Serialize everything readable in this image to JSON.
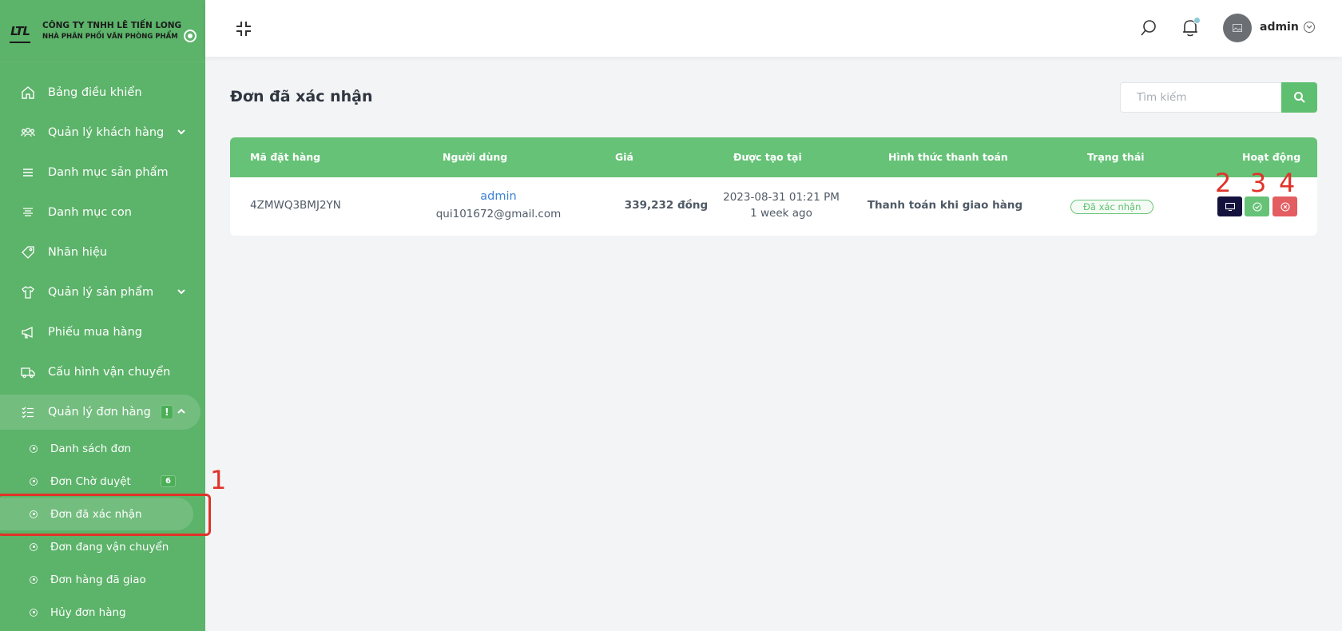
{
  "brand": {
    "logo": "LTL",
    "line1": "CÔNG TY TNHH LÊ TIẾN LONG",
    "line2": "NHÀ PHÂN PHỐI VĂN PHÒNG PHẨM"
  },
  "sidebar": {
    "items": [
      {
        "label": "Bảng điều khiển",
        "icon": "home-icon"
      },
      {
        "label": "Quản lý khách hàng",
        "icon": "users-icon"
      },
      {
        "label": "Danh mục sản phẩm",
        "icon": "list-icon"
      },
      {
        "label": "Danh mục con",
        "icon": "sublist-icon"
      },
      {
        "label": "Nhãn hiệu",
        "icon": "tag-icon"
      },
      {
        "label": "Quản lý sản phẩm",
        "icon": "shirt-icon"
      },
      {
        "label": "Phiếu mua hàng",
        "icon": "megaphone-icon"
      },
      {
        "label": "Cấu hình vận chuyển",
        "icon": "truck-icon"
      },
      {
        "label": "Quản lý đơn hàng",
        "icon": "checklist-icon",
        "badge": "!"
      }
    ],
    "subitems": [
      {
        "label": "Danh sách đơn"
      },
      {
        "label": "Đơn Chờ duyệt",
        "badge": "6"
      },
      {
        "label": "Đơn đã xác nhận"
      },
      {
        "label": "Đơn đang vận chuyển"
      },
      {
        "label": "Đơn hàng đã giao"
      },
      {
        "label": "Hủy đơn hàng"
      }
    ]
  },
  "header": {
    "user": "admin"
  },
  "main": {
    "title": "Đơn đã xác nhận",
    "search_placeholder": "Tìm kiếm",
    "columns": [
      "Mã đặt hàng",
      "Người dùng",
      "Giá",
      "Được tạo tại",
      "Hình thức thanh toán",
      "Trạng thái",
      "Hoạt động"
    ],
    "row": {
      "code": "4ZMWQ3BMJ2YN",
      "user_name": "admin",
      "user_email": "qui101672@gmail.com",
      "price": "339,232 đồng",
      "created_date": "2023-08-31 01:21 PM",
      "created_ago": "1 week ago",
      "payment": "Thanh toán khi giao hàng",
      "status": "Đã xác nhận"
    }
  },
  "annotations": [
    "1",
    "2",
    "3",
    "4"
  ],
  "colors": {
    "sidebar": "#5cb36a",
    "table_header": "#66c277",
    "view_button": "#14123d",
    "confirm_button": "#66c277",
    "cancel_button": "#e35d61",
    "annotation": "#e03228"
  }
}
